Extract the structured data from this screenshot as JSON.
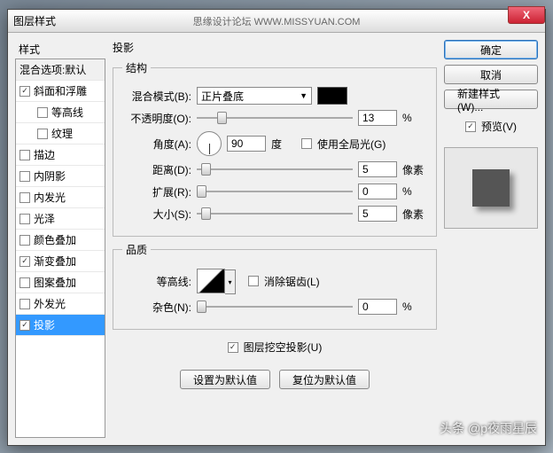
{
  "titlebar": {
    "title": "图层样式",
    "credit": "思缘设计论坛  WWW.MISSYUAN.COM",
    "close": "X"
  },
  "left": {
    "header": "样式",
    "blend_defaults": "混合选项:默认",
    "items": [
      {
        "label": "斜面和浮雕",
        "checked": true,
        "indent": false
      },
      {
        "label": "等高线",
        "checked": false,
        "indent": true
      },
      {
        "label": "纹理",
        "checked": false,
        "indent": true
      },
      {
        "label": "描边",
        "checked": false,
        "indent": false
      },
      {
        "label": "内阴影",
        "checked": false,
        "indent": false
      },
      {
        "label": "内发光",
        "checked": false,
        "indent": false
      },
      {
        "label": "光泽",
        "checked": false,
        "indent": false
      },
      {
        "label": "颜色叠加",
        "checked": false,
        "indent": false
      },
      {
        "label": "渐变叠加",
        "checked": true,
        "indent": false
      },
      {
        "label": "图案叠加",
        "checked": false,
        "indent": false
      },
      {
        "label": "外发光",
        "checked": false,
        "indent": false
      },
      {
        "label": "投影",
        "checked": true,
        "indent": false,
        "selected": true
      }
    ]
  },
  "center": {
    "section_title": "投影",
    "structure": {
      "legend": "结构",
      "blend_mode_label": "混合模式(B):",
      "blend_mode_value": "正片叠底",
      "opacity_label": "不透明度(O):",
      "opacity_value": "13",
      "opacity_unit": "%",
      "angle_label": "角度(A):",
      "angle_value": "90",
      "angle_unit": "度",
      "global_light_label": "使用全局光(G)",
      "distance_label": "距离(D):",
      "distance_value": "5",
      "distance_unit": "像素",
      "spread_label": "扩展(R):",
      "spread_value": "0",
      "spread_unit": "%",
      "size_label": "大小(S):",
      "size_value": "5",
      "size_unit": "像素"
    },
    "quality": {
      "legend": "品质",
      "contour_label": "等高线:",
      "antialias_label": "消除锯齿(L)",
      "noise_label": "杂色(N):",
      "noise_value": "0",
      "noise_unit": "%"
    },
    "knockout_label": "图层挖空投影(U)",
    "make_default": "设置为默认值",
    "reset_default": "复位为默认值"
  },
  "right": {
    "ok": "确定",
    "cancel": "取消",
    "new_style": "新建样式(W)...",
    "preview_label": "预览(V)"
  },
  "watermark": "头条 @p夜雨星辰"
}
